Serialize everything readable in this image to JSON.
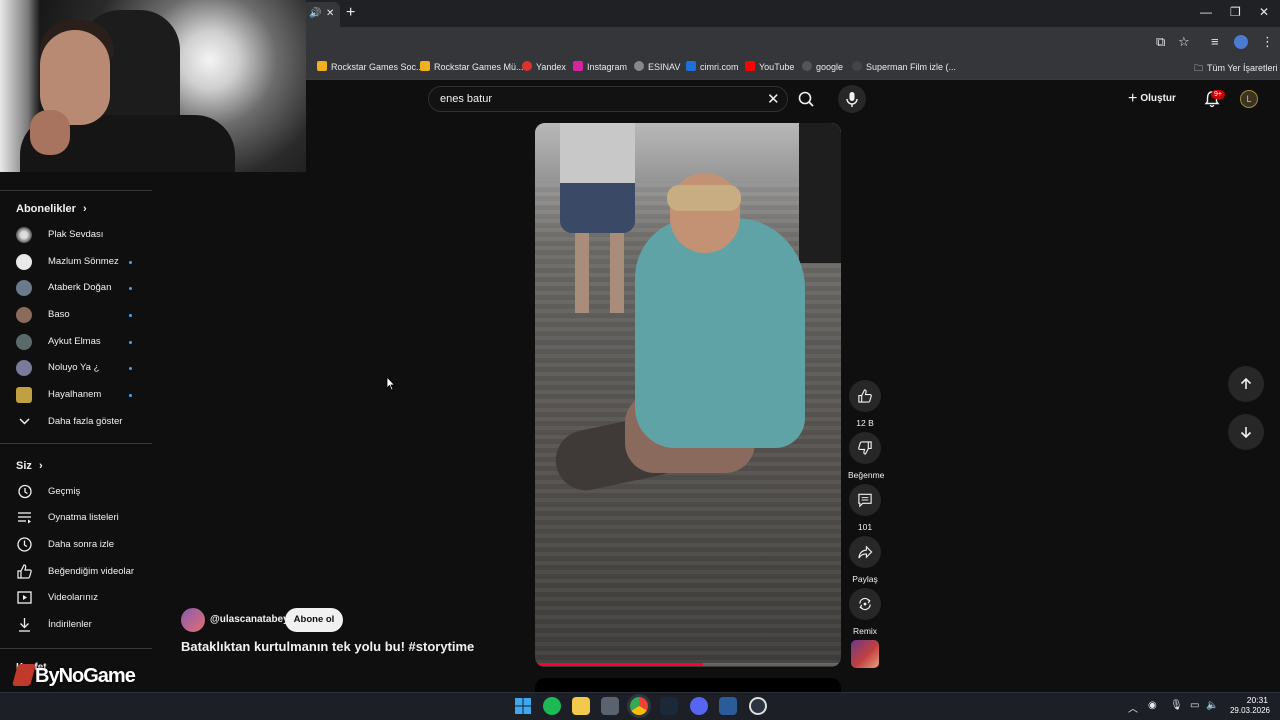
{
  "browser": {
    "bookmarks": [
      "Rockstar Games Soc...",
      "Rockstar Games Mü...",
      "Yandex",
      "Instagram",
      "ESINAV",
      "cimri.com",
      "YouTube",
      "google",
      "Superman Film izle (..."
    ],
    "all_bookmarks_label": "Tüm Yer İşaretleri"
  },
  "header": {
    "search_value": "enes batur",
    "create_label": "Oluştur",
    "notification_badge": "9+"
  },
  "sidebar": {
    "subscriptions_heading": "Abonelikler",
    "subscriptions": [
      {
        "label": "Plak Sevdası",
        "dot": false
      },
      {
        "label": "Mazlum Sönmez",
        "dot": true
      },
      {
        "label": "Ataberk Doğan",
        "dot": true
      },
      {
        "label": "Baso",
        "dot": true
      },
      {
        "label": "Aykut Elmas",
        "dot": true
      },
      {
        "label": "Noluyo Ya ¿",
        "dot": true
      },
      {
        "label": "Hayalhanem",
        "dot": true
      }
    ],
    "show_more": "Daha fazla göster",
    "you_heading": "Siz",
    "you_items": [
      "Geçmiş",
      "Oynatma listeleri",
      "Daha sonra izle",
      "Beğendiğim videolar",
      "Videolarınız",
      "İndirilenler"
    ],
    "explore_heading": "Keşfet"
  },
  "short": {
    "channel_handle": "@ulascanatabey",
    "subscribe_label": "Abone ol",
    "title": "Bataklıktan kurtulmanın tek yolu bu! #storytime",
    "progress_fraction": 0.55,
    "actions": {
      "like_count": "12 B",
      "dislike_label": "Beğenme",
      "comment_count": "101",
      "share_label": "Paylaş",
      "remix_label": "Remix"
    }
  },
  "watermark": "ByNoGame",
  "taskbar": {
    "time": "20:31",
    "date": "29.03.2026"
  },
  "colors": {
    "background": "#0f0f0f",
    "accent_red": "#ff0033",
    "subscription_dot": "#3ea6ff"
  }
}
